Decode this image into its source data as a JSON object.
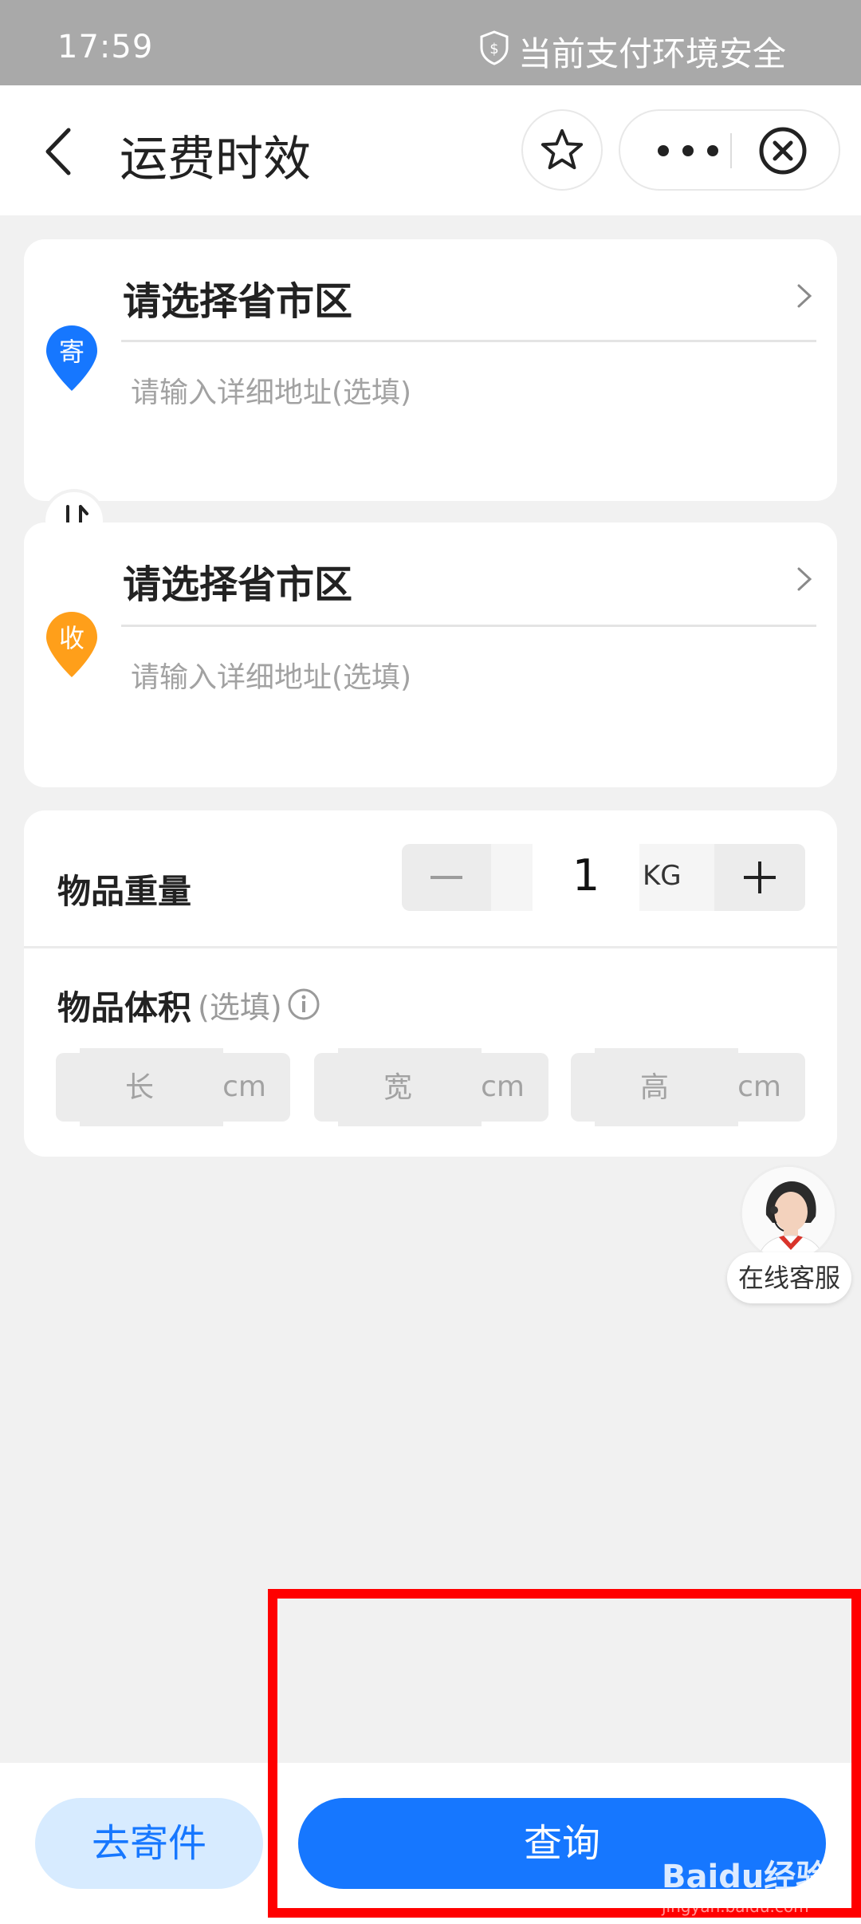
{
  "status_bar": {
    "time": "17:59",
    "secure_text": "当前支付环境安全"
  },
  "nav": {
    "title": "运费时效"
  },
  "sender": {
    "badge": "寄",
    "region_label": "请选择省市区",
    "address_placeholder": "请输入详细地址(选填)"
  },
  "receiver": {
    "badge": "收",
    "region_label": "请选择省市区",
    "address_placeholder": "请输入详细地址(选填)"
  },
  "goods": {
    "weight_label": "物品重量",
    "weight_value": "1",
    "weight_unit": "KG",
    "volume_label": "物品体积",
    "volume_optional": "(选填)",
    "dimensions": [
      {
        "placeholder": "长",
        "unit": "cm"
      },
      {
        "placeholder": "宽",
        "unit": "cm"
      },
      {
        "placeholder": "高",
        "unit": "cm"
      }
    ]
  },
  "customer_service": {
    "label": "在线客服"
  },
  "bottom": {
    "send_button": "去寄件",
    "query_button": "查询"
  },
  "watermark": {
    "brand": "Baidu经验",
    "sub": "jingyan.baidu.com"
  },
  "colors": {
    "primary": "#1677ff",
    "sender_pin": "#1677ff",
    "receiver_pin": "#ff9f1a",
    "highlight": "#ff0000"
  }
}
